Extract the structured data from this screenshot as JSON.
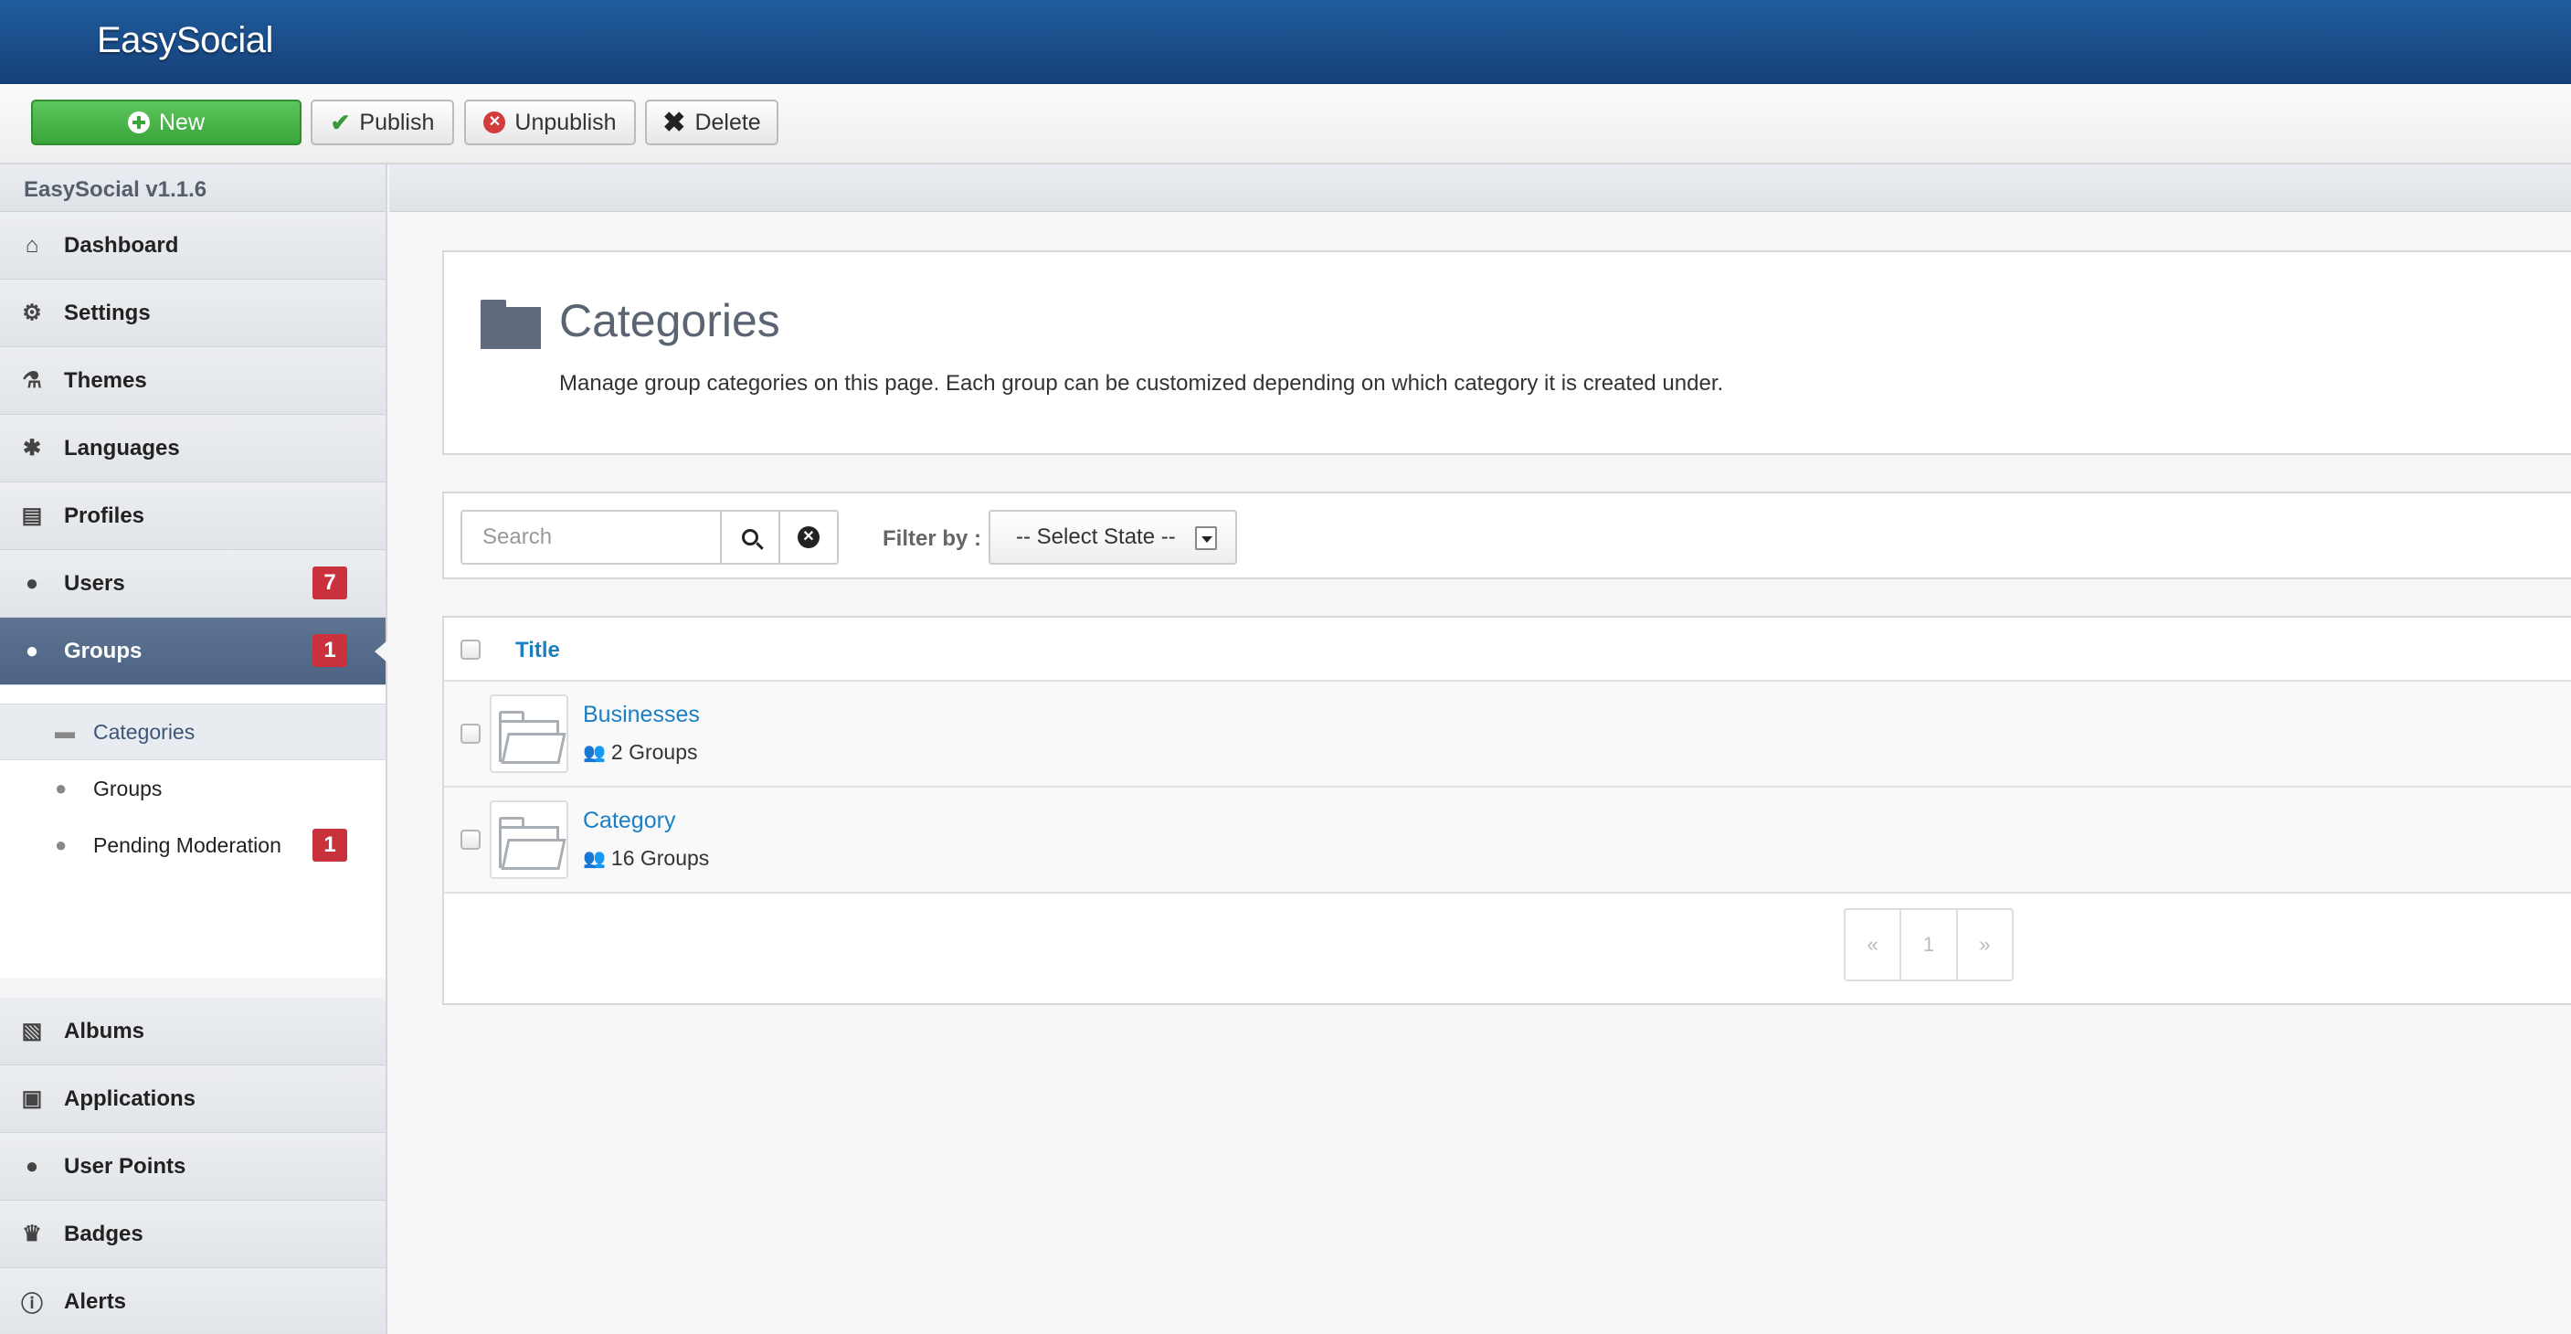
{
  "app": {
    "brand": "EasySocial",
    "version": "EasySocial v1.1.6"
  },
  "toolbar": {
    "new_label": "New",
    "publish_label": "Publish",
    "unpublish_label": "Unpublish",
    "delete_label": "Delete"
  },
  "sidebar": {
    "items": [
      {
        "label": "Dashboard",
        "icon": "home-icon"
      },
      {
        "label": "Settings",
        "icon": "gear-icon"
      },
      {
        "label": "Themes",
        "icon": "flask-icon"
      },
      {
        "label": "Languages",
        "icon": "puzzle-icon"
      },
      {
        "label": "Profiles",
        "icon": "id-card-icon"
      },
      {
        "label": "Users",
        "icon": "user-icon",
        "badge": "7"
      },
      {
        "label": "Groups",
        "icon": "users-icon",
        "badge": "1",
        "active": true
      }
    ],
    "subitems": [
      {
        "label": "Categories",
        "icon": "folder-icon",
        "active": true
      },
      {
        "label": "Groups",
        "icon": "users-icon"
      },
      {
        "label": "Pending Moderation",
        "icon": "users-icon",
        "badge": "1"
      }
    ],
    "bottom_items": [
      {
        "label": "Albums",
        "icon": "album-icon"
      },
      {
        "label": "Applications",
        "icon": "app-icon"
      },
      {
        "label": "User Points",
        "icon": "circle-icon"
      },
      {
        "label": "Badges",
        "icon": "crown-icon"
      },
      {
        "label": "Alerts",
        "icon": "alert-icon"
      }
    ]
  },
  "header": {
    "title": "Categories",
    "description": "Manage group categories on this page. Each group can be customized depending on which category it is created under."
  },
  "filters": {
    "search_placeholder": "Search",
    "filter_label": "Filter by :",
    "state_select": "-- Select State --"
  },
  "table": {
    "column_title": "Title",
    "rows": [
      {
        "title": "Businesses",
        "meta": "2 Groups"
      },
      {
        "title": "Category",
        "meta": "16 Groups"
      }
    ]
  },
  "pagination": {
    "prev": "«",
    "page": "1",
    "next": "»"
  },
  "colors": {
    "topbar": "#1f5d9c",
    "accent_blue": "#1b7fc4",
    "badge_red": "#c9323c",
    "new_green": "#3aa53a",
    "active_nav": "#5e7493"
  }
}
